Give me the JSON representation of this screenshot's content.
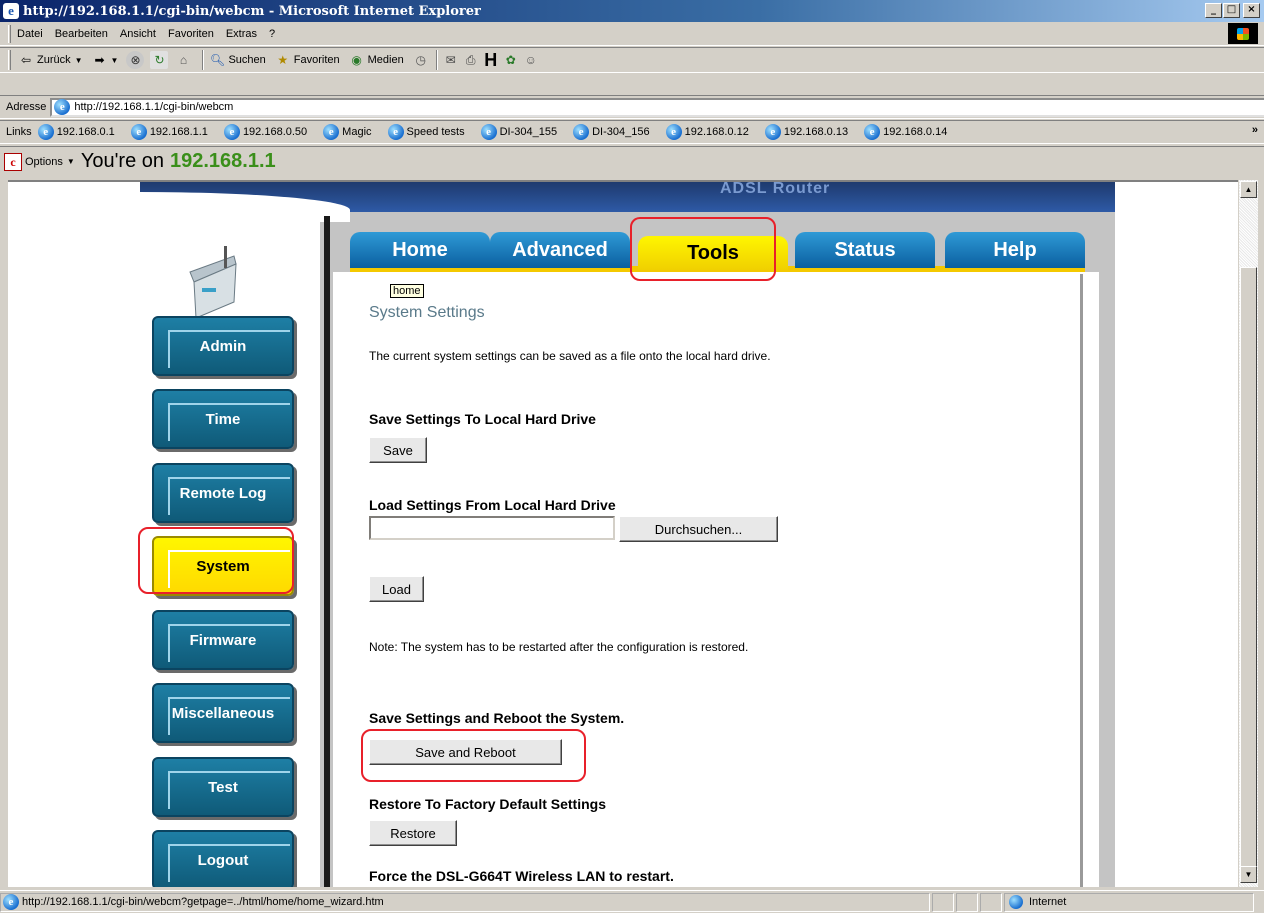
{
  "window": {
    "title": "http://192.168.1.1/cgi-bin/webcm - Microsoft Internet Explorer",
    "min": "_",
    "max": "□",
    "close": "×"
  },
  "menu": [
    "Datei",
    "Bearbeiten",
    "Ansicht",
    "Favoriten",
    "Extras",
    "?"
  ],
  "toolbar": {
    "back": "Zurück",
    "search": "Suchen",
    "favorites": "Favoriten",
    "media": "Medien"
  },
  "address": {
    "label": "Adresse",
    "url": "http://192.168.1.1/cgi-bin/webcm"
  },
  "links": {
    "label": "Links",
    "items": [
      "192.168.0.1",
      "192.168.1.1",
      "192.168.0.50",
      "Magic",
      "Speed tests",
      "DI-304_155",
      "DI-304_156",
      "192.168.0.12",
      "192.168.0.13",
      "192.168.0.14"
    ],
    "more": "»"
  },
  "options_bar": {
    "options": "Options",
    "youre_on": "You're on",
    "ip": "192.168.1.1"
  },
  "router": {
    "brand": "ADSL Router",
    "tabs": [
      "Home",
      "Advanced",
      "Tools",
      "Status",
      "Help"
    ],
    "selected_tab": "Tools",
    "sidebar": [
      "Admin",
      "Time",
      "Remote Log",
      "System",
      "Firmware",
      "Miscellaneous",
      "Test",
      "Logout"
    ],
    "selected_sidebar": "System",
    "tooltip": "home",
    "title": "System Settings",
    "intro": "The current system settings can be saved as a file onto the local hard drive.",
    "save_heading": "Save Settings To Local Hard Drive",
    "save_btn": "Save",
    "load_heading": "Load Settings From Local Hard Drive",
    "file_value": "",
    "browse_btn": "Durchsuchen...",
    "load_btn": "Load",
    "note": "Note: The system has to be restarted after the configuration is restored.",
    "reboot_heading": "Save Settings and Reboot the System.",
    "reboot_btn": "Save and Reboot",
    "restore_heading": "Restore To Factory Default Settings",
    "restore_btn": "Restore",
    "force_heading": "Force the DSL-G664T Wireless LAN to restart."
  },
  "status": {
    "text": "http://192.168.1.1/cgi-bin/webcm?getpage=../html/home/home_wizard.htm",
    "zone": "Internet"
  },
  "colors": {
    "tab_blue": "#1a78c2",
    "tab_yellow": "#fff200",
    "highlight_red": "#e8202a",
    "sidebar_teal": "#17709a"
  }
}
